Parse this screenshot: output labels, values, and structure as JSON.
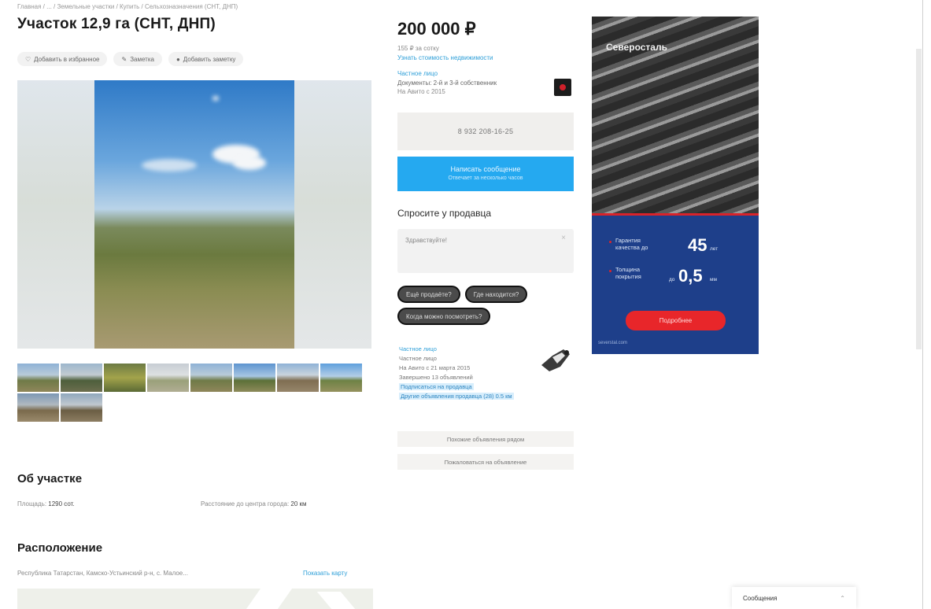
{
  "listing": {
    "breadcrumb": "Главная / ... / Земельные участки / Купить / Сельхозназначения (СНТ, ДНП)",
    "title": "Участок 12,9 га (СНТ, ДНП)",
    "actions": [
      {
        "label": "Добавить в избранное",
        "icon": "heart-icon"
      },
      {
        "label": "Заметка",
        "icon": "note-icon"
      },
      {
        "label": "Добавить заметку",
        "icon": "pin-icon"
      }
    ],
    "thumbnail_count": 10
  },
  "about": {
    "heading": "Об участке",
    "area_label": "Площадь:",
    "area_value": "1290 сот.",
    "distance_label": "Расстояние до центра города:",
    "distance_value": "20 км"
  },
  "location": {
    "heading": "Расположение",
    "address": "Республика Татарстан, Камско-Устьинский р-н, с. Малое...",
    "map_link": "Показать карту"
  },
  "sidebar": {
    "price": "200 000 ₽",
    "price_note": "155 ₽ за сотку",
    "price_link": "Узнать стоимость недвижимости",
    "seller_link": "Частное лицо",
    "seller_name": "Документы: 2-й и 3-й собственник",
    "seller_sub": "На Авито с 2015",
    "phone": "8 932 208-16-25",
    "message_button": "Написать сообщение",
    "message_sub": "Отвечает за несколько часов",
    "ask_title": "Спросите у продавца",
    "ask_placeholder": "Здравствуйте!",
    "chips": [
      "Ещё продаёте?",
      "Где находится?",
      "Когда можно посмотреть?"
    ],
    "info": [
      {
        "text": "Частное лицо",
        "style": "link"
      },
      {
        "text": "Частное лицо",
        "style": "plain"
      },
      {
        "text": "На Авито с 21 марта 2015",
        "style": "plain"
      },
      {
        "text": "Завершено 13 объявлений",
        "style": "plain"
      },
      {
        "text": "Подписаться на продавца",
        "style": "hl"
      },
      {
        "text": "Другие объявления продавца (28) 0.5 км",
        "style": "hl"
      }
    ],
    "btn_similar": "Похожие объявления рядом",
    "btn_complain": "Пожаловаться на объявление"
  },
  "ad": {
    "brand": "Северосталь",
    "feature1": [
      "Гарантия",
      "качества до"
    ],
    "value1": "45",
    "unit1": "лет",
    "feature2": [
      "Толщина",
      "покрытия"
    ],
    "prefix2": "до",
    "value2": "0,5",
    "unit2": "мм",
    "cta": "Подробнее",
    "footer": "severstal.com"
  },
  "chat": {
    "label": "Сообщения",
    "icon": "chevron-up-icon"
  }
}
